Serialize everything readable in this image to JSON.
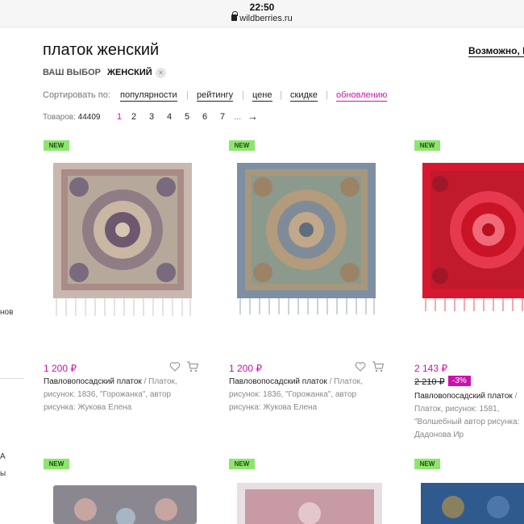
{
  "statusbar": {
    "time": "22:50",
    "url": "wildberries.ru"
  },
  "sidebar": {
    "frag1": "нов",
    "frag2": "A",
    "frag3": "ы"
  },
  "header": {
    "title": "платок женский",
    "maybe": "Возможно, В"
  },
  "choice": {
    "label": "ВАШ ВЫБОР",
    "tag": "ЖЕНСКИЙ",
    "remove": "×"
  },
  "sort": {
    "label": "Сортировать по:",
    "options": [
      "популярности",
      "рейтингу",
      "цене",
      "скидке",
      "обновлению"
    ],
    "separator": "|"
  },
  "count": {
    "label": "Товаров:",
    "value": "44409"
  },
  "pagination": {
    "pages": [
      "1",
      "2",
      "3",
      "4",
      "5",
      "6",
      "7"
    ],
    "ellipsis": "...",
    "next": "→"
  },
  "colors": {
    "accent": "#cb11ab",
    "badge": "#8ee56e"
  },
  "products": [
    {
      "badge": "NEW",
      "price": "1 200 ₽",
      "brand": "Павловопосадский платок",
      "description": " / Платок, рисунок: 1836, \"Горожанка\", автор рисунка: Жукова Елена"
    },
    {
      "badge": "NEW",
      "price": "1 200 ₽",
      "brand": "Павловопосадский платок",
      "description": " / Платок, рисунок: 1836, \"Горожанка\", автор рисунка: Жукова Елена"
    },
    {
      "badge": "NEW",
      "price": "2 143 ₽",
      "old_price": "2 210 ₽",
      "discount": "-3%",
      "brand": "Павловопосадский платок",
      "description": " / Платок, рисунок: 1581, \"Волшебный автор рисунка: Дадонова Ир"
    },
    {
      "badge": "NEW"
    },
    {
      "badge": "NEW"
    },
    {
      "badge": "NEW"
    }
  ],
  "icons": {
    "favorite": "heart-icon",
    "cart": "cart-icon",
    "secure": "lock-icon"
  }
}
